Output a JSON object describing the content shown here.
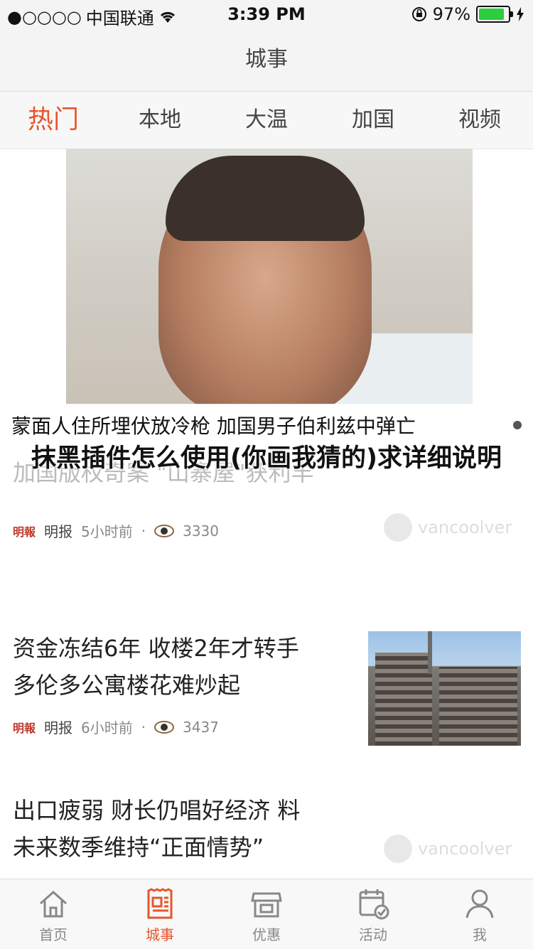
{
  "status_bar": {
    "signal": "●○○○○",
    "carrier": "中国联通",
    "time": "3:39 PM",
    "battery_percent": "97%",
    "battery_level": 0.97
  },
  "nav": {
    "title": "城事"
  },
  "tabs": [
    {
      "label": "热门",
      "active": true
    },
    {
      "label": "本地",
      "active": false
    },
    {
      "label": "大温",
      "active": false
    },
    {
      "label": "加国",
      "active": false
    },
    {
      "label": "视频",
      "active": false
    }
  ],
  "hero": {
    "caption": "蒙面人住所埋伏放冷枪 加国男子伯利兹中弹亡"
  },
  "overlay_title": "抹黑插件怎么使用(你画我猜的)求详细说明",
  "articles": [
    {
      "headline": "加国版权奇案 \"山寨屋\"获利丰",
      "source_logo": "明報",
      "source": "明报",
      "time": "5小时前",
      "views": "3330",
      "watermark": "vancoolver"
    },
    {
      "headline_line1": "资金冻结6年 收楼2年才转手",
      "headline_line2": "多伦多公寓楼花难炒起",
      "source_logo": "明報",
      "source": "明报",
      "time": "6小时前",
      "views": "3437"
    },
    {
      "headline_line1": "出口疲弱 财长仍唱好经济 料",
      "headline_line2": "未来数季维持“正面情势”",
      "watermark": "vancoolver"
    }
  ],
  "bottom_tabs": [
    {
      "label": "首页",
      "icon": "home-icon",
      "active": false
    },
    {
      "label": "城事",
      "icon": "newspaper-icon",
      "active": true
    },
    {
      "label": "优惠",
      "icon": "store-icon",
      "active": false
    },
    {
      "label": "活动",
      "icon": "calendar-check-icon",
      "active": false
    },
    {
      "label": "我",
      "icon": "person-icon",
      "active": false
    }
  ],
  "colors": {
    "accent": "#e8552b",
    "battery": "#2ecc40"
  }
}
